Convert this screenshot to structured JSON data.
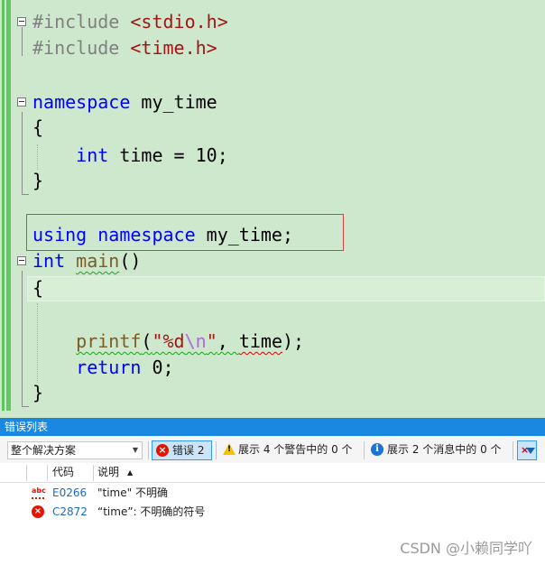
{
  "editor": {
    "lines": {
      "l1": {
        "pp": "#include ",
        "arg": "<stdio.h>"
      },
      "l2": {
        "pp": "#include ",
        "arg": "<time.h>"
      },
      "l4": {
        "kw": "namespace",
        "name": " my_time"
      },
      "l5": {
        "text": "{"
      },
      "l6": {
        "indent": "    ",
        "kw": "int",
        "rest": " time = 10;"
      },
      "l7": {
        "text": "}"
      },
      "l9": {
        "kw1": "using",
        "sp": " ",
        "kw2": "namespace",
        "rest": " my_time;"
      },
      "l10": {
        "kw": "int",
        "sp": " ",
        "fn": "main",
        "rest": "()"
      },
      "l11": {
        "text": "{"
      },
      "l13": {
        "indent": "    ",
        "fn": "printf",
        "open": "(",
        "str1": "\"%d",
        "esc": "\\n",
        "str2": "\"",
        "comma": ", ",
        "arg": "time",
        "close": ");"
      },
      "l14": {
        "indent": "    ",
        "kw": "return",
        "rest": " 0;"
      },
      "l15": {
        "text": "}"
      }
    }
  },
  "error_list": {
    "title": "错误列表",
    "scope": "整个解决方案",
    "errors_btn": "错误 2",
    "warnings_btn": "展示 4 个警告中的 0 个",
    "messages_btn": "展示 2 个消息中的 0 个",
    "columns": {
      "code": "代码",
      "desc": "说明",
      "sort_glyph": "▲"
    },
    "rows": [
      {
        "code": "E0266",
        "desc": "\"time\" 不明确"
      },
      {
        "code": "C2872",
        "desc": "“time”: 不明确的符号"
      }
    ]
  },
  "icons": {
    "error": "error-circle-icon",
    "warning": "warning-triangle-icon",
    "info": "info-circle-icon",
    "spell": "abc-squiggle-icon",
    "filter": "filter-funnel-icon"
  },
  "watermark": "CSDN @小赖同学吖",
  "colors": {
    "editor_bg": "#cde8cc",
    "keyword": "#0000ff",
    "string": "#a31515",
    "preprocessor": "#808080",
    "accent": "#1a88e0",
    "error": "#e51400",
    "highlight_box": "#e04040"
  }
}
